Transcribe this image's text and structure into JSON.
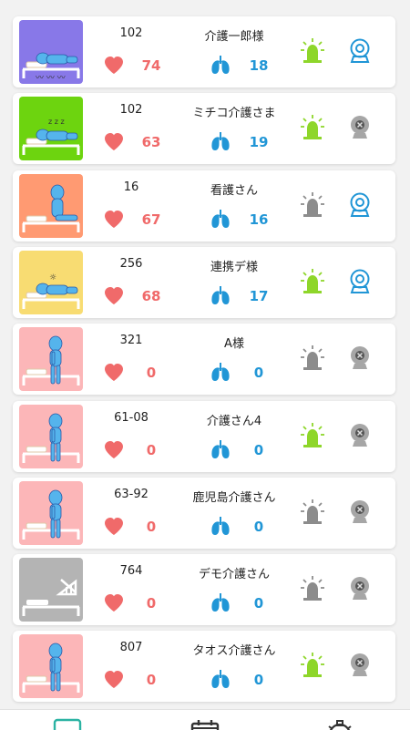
{
  "patients": [
    {
      "room": "102",
      "name": "介護一郎様",
      "heart_rate": "74",
      "resp_rate": "18",
      "state": "lying-sleep",
      "thumb_color": "#8878e8",
      "alarm_active": true,
      "camera_active": true
    },
    {
      "room": "102",
      "name": "ミチコ介護さま",
      "heart_rate": "63",
      "resp_rate": "19",
      "state": "lying-zzz",
      "thumb_color": "#6dd40f",
      "alarm_active": true,
      "camera_active": false
    },
    {
      "room": "16",
      "name": "看護さん",
      "heart_rate": "67",
      "resp_rate": "16",
      "state": "sitting",
      "thumb_color": "#ff9a72",
      "alarm_active": false,
      "camera_active": true
    },
    {
      "room": "256",
      "name": "連携デ様",
      "heart_rate": "68",
      "resp_rate": "17",
      "state": "lying-sun",
      "thumb_color": "#f8dc72",
      "alarm_active": true,
      "camera_active": true
    },
    {
      "room": "321",
      "name": "A様",
      "heart_rate": "0",
      "resp_rate": "0",
      "state": "standing",
      "thumb_color": "#fcb6b8",
      "alarm_active": false,
      "camera_active": false
    },
    {
      "room": "61-08",
      "name": "介護さん4",
      "heart_rate": "0",
      "resp_rate": "0",
      "state": "standing",
      "thumb_color": "#fcb6b8",
      "alarm_active": true,
      "camera_active": false
    },
    {
      "room": "63-92",
      "name": "鹿児島介護さん",
      "heart_rate": "0",
      "resp_rate": "0",
      "state": "standing",
      "thumb_color": "#fcb6b8",
      "alarm_active": false,
      "camera_active": false
    },
    {
      "room": "764",
      "name": "デモ介護さん",
      "heart_rate": "0",
      "resp_rate": "0",
      "state": "offline",
      "thumb_color": "#b4b4b4",
      "alarm_active": false,
      "camera_active": false
    },
    {
      "room": "807",
      "name": "タオス介護さん",
      "heart_rate": "0",
      "resp_rate": "0",
      "state": "standing",
      "thumb_color": "#fcb6b8",
      "alarm_active": true,
      "camera_active": false
    }
  ],
  "colors": {
    "heart": "#f06a6a",
    "lung": "#2196d6",
    "alarm_active": "#8ed62a",
    "alarm_inactive": "#8c8c8c",
    "camera_active": "#2196d6",
    "camera_inactive": "#a6a6a6",
    "figure": "#55b4ec",
    "nav_active": "#2bb3a3",
    "nav_inactive": "#333333"
  },
  "nav": [
    {
      "icon": "monitor-icon",
      "active": true
    },
    {
      "icon": "calendar-icon",
      "active": false
    },
    {
      "icon": "settings-gear-icon",
      "active": false
    }
  ]
}
